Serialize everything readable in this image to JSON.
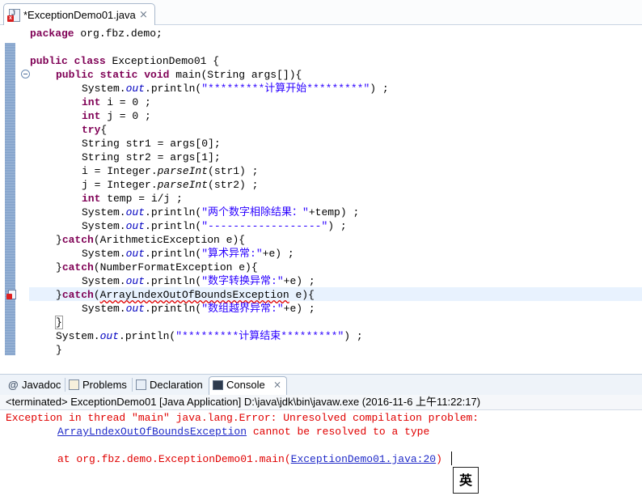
{
  "editor_tab": {
    "title": "*ExceptionDemo01.java",
    "close_glyph": "⨯",
    "icon": "java-file-error-icon"
  },
  "code": {
    "l1": {
      "kw": "package",
      "rest": " org.fbz.demo;"
    },
    "l3": {
      "kw1": "public",
      "kw2": "class",
      "rest": " ExceptionDemo01 {"
    },
    "l4": {
      "kw1": "public",
      "kw2": "static",
      "kw3": "void",
      "rest": " main(String args[]){"
    },
    "l5": {
      "a": "System.",
      "f": "out",
      "b": ".println(",
      "s": "\"*********计算开始*********\"",
      "c": ") ;"
    },
    "l6": {
      "kw": "int",
      "rest": " i = 0 ;"
    },
    "l7": {
      "kw": "int",
      "rest": " j = 0 ;"
    },
    "l8": {
      "kw": "try",
      "rest": "{"
    },
    "l9": "String str1 = args[0];",
    "l10": "String str2 = args[1];",
    "l11": {
      "a": "i = Integer.",
      "m": "parseInt",
      "b": "(str1) ;"
    },
    "l12": {
      "a": "j = Integer.",
      "m": "parseInt",
      "b": "(str2) ;"
    },
    "l13": {
      "kw": "int",
      "rest": " temp = i/j ;"
    },
    "l14": {
      "a": "System.",
      "f": "out",
      "b": ".println(",
      "s": "\"两个数字相除结果：\"",
      "c": "+temp) ;"
    },
    "l15": {
      "a": "System.",
      "f": "out",
      "b": ".println(",
      "s": "\"------------------\"",
      "c": ") ;"
    },
    "l16": {
      "a": "}",
      "kw": "catch",
      "b": "(ArithmeticException e){"
    },
    "l17": {
      "a": "System.",
      "f": "out",
      "b": ".println(",
      "s": "\"算术异常:\"",
      "c": "+e) ;"
    },
    "l18": {
      "a": "}",
      "kw": "catch",
      "b": "(NumberFormatException e){"
    },
    "l19": {
      "a": "System.",
      "f": "out",
      "b": ".println(",
      "s": "\"数字转换异常:\"",
      "c": "+e) ;"
    },
    "l20": {
      "a": "}",
      "kw": "catch",
      "p": "(",
      "err": "ArrayLndexOutOfBoundsException",
      "b": " e){"
    },
    "l21": {
      "a": "System.",
      "f": "out",
      "b": ".println(",
      "s": "\"数组越界异常:\"",
      "c": "+e) ;"
    },
    "l22": "}",
    "l23": {
      "a": "System.",
      "f": "out",
      "b": ".println(",
      "s": "\"*********计算结束*********\"",
      "c": ") ;"
    },
    "l24": "}"
  },
  "panel_tabs": {
    "javadoc": {
      "label": "Javadoc",
      "icon": "at-icon"
    },
    "problems": {
      "label": "Problems",
      "icon": "problems-icon"
    },
    "declaration": {
      "label": "Declaration",
      "icon": "declaration-icon"
    },
    "console": {
      "label": "Console",
      "icon": "console-icon",
      "close": "⨯"
    }
  },
  "console": {
    "header": "<terminated> ExceptionDemo01 [Java Application] D:\\java\\jdk\\bin\\javaw.exe (2016-11-6 上午11:22:17)",
    "line1": "Exception in thread \"main\" java.lang.Error: Unresolved compilation problem: ",
    "line2_link": "ArrayLndexOutOfBoundsException",
    "line2_rest": " cannot be resolved to a type",
    "line4_prefix": "at org.fbz.demo.ExceptionDemo01.main(",
    "line4_link": "ExceptionDemo01.java:20",
    "line4_suffix": ")"
  },
  "ime": {
    "label": "英"
  },
  "colors": {
    "keyword": "#7f0055",
    "string": "#2a00ff",
    "field": "#0000c0",
    "console_error": "#e00000",
    "link": "#1f2ac8"
  }
}
